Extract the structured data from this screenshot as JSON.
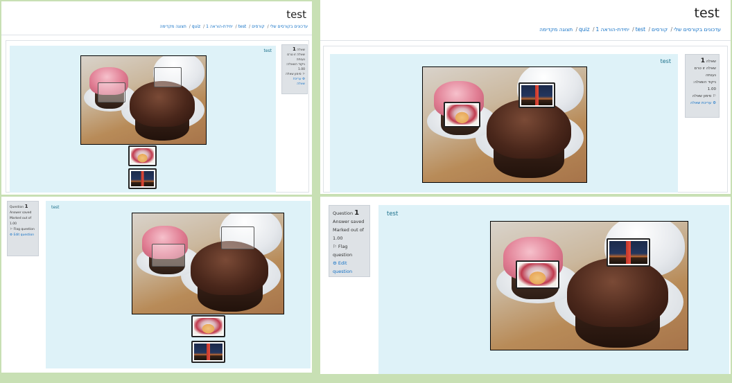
{
  "rtl_view": {
    "page_title": "test",
    "breadcrumb": [
      "עדכונים בקורסים שלי",
      "קורסים",
      "test",
      "יחידת-הוראה 1",
      "quiz",
      "תצוגה מקדימה"
    ],
    "question_info": {
      "label": "שאלה",
      "number": "1",
      "status": "שאלה זו טרם נענתה",
      "marked_label": "ניקוד השאלה:",
      "marked_value": "1.00",
      "flag_label": "סימון שאלה",
      "edit_label": "עריכת שאלה"
    },
    "question_text": "test"
  },
  "ltr_view": {
    "question_info": {
      "label": "Question",
      "number": "1",
      "status": "Answer saved",
      "marked_label": "Marked out of",
      "marked_value": "1.00",
      "flag_label": "Flag question",
      "edit_label": "Edit question"
    },
    "question_text": "test"
  },
  "icons": {
    "flag": "flag-icon",
    "gear": "gear-icon",
    "draggable_1": "cupcake-thumbnail",
    "draggable_2": "lighthouse-thumbnail"
  },
  "colors": {
    "link": "#0f6fc5",
    "question_text_bg": "#def2f8",
    "info_bg": "#dee2e6",
    "outer_bg": "#c8e0b4"
  }
}
